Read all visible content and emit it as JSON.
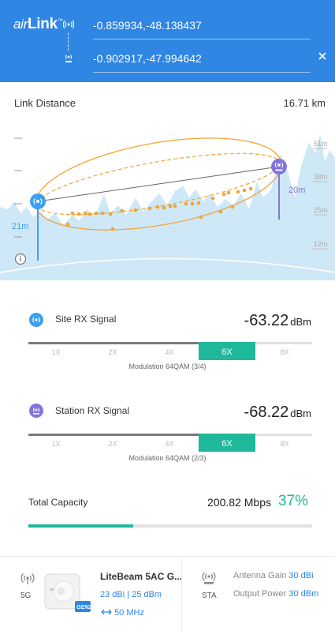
{
  "header": {
    "logo": {
      "prefix": "air",
      "suffix": "Link",
      "tm": "™"
    },
    "site_coords": "-0.859934,-48.138437",
    "station_coords": "-0.902917,-47.994642",
    "close_icon": "close-icon",
    "site_icon": "antenna-icon",
    "station_icon": "station-icon"
  },
  "link": {
    "label": "Link Distance",
    "value": "16.71 km"
  },
  "profile": {
    "scale_labels": [
      "51m",
      "38m",
      "25m",
      "12m"
    ],
    "site_height": "21m",
    "station_height": "20m",
    "info_icon": "info-icon"
  },
  "site_rx": {
    "label": "Site RX Signal",
    "value": "-63.22",
    "unit": "dBm",
    "levels": [
      "1X",
      "2X",
      "4X",
      "6X",
      "8X"
    ],
    "active_level": "6X",
    "modulation": "Modulation 64QAM (3/4)"
  },
  "station_rx": {
    "label": "Station RX Signal",
    "value": "-68.22",
    "unit": "dBm",
    "levels": [
      "1X",
      "2X",
      "4X",
      "6X",
      "8X"
    ],
    "active_level": "6X",
    "modulation": "Modulation 64QAM (2/3)"
  },
  "capacity": {
    "label": "Total Capacity",
    "value": "200.82 Mbps",
    "percent": "37%",
    "fraction": 0.37
  },
  "footer": {
    "band": "5G",
    "device_name": "LiteBeam 5AC G...",
    "device_spec": "23 dBi | 25 dBm",
    "channel_width": "50 MHz",
    "device_badge": "GEN2",
    "mode": "STA",
    "antenna_gain_label": "Antenna Gain",
    "antenna_gain_value": "30 dBi",
    "output_power_label": "Output Power",
    "output_power_value": "30 dBm"
  },
  "colors": {
    "header": "#2f86e3",
    "accent_green": "#1fb89b",
    "site": "#3da0f0",
    "station": "#8573dd",
    "fresnel": "#f0a534",
    "terrain": "#cfe8f7"
  }
}
